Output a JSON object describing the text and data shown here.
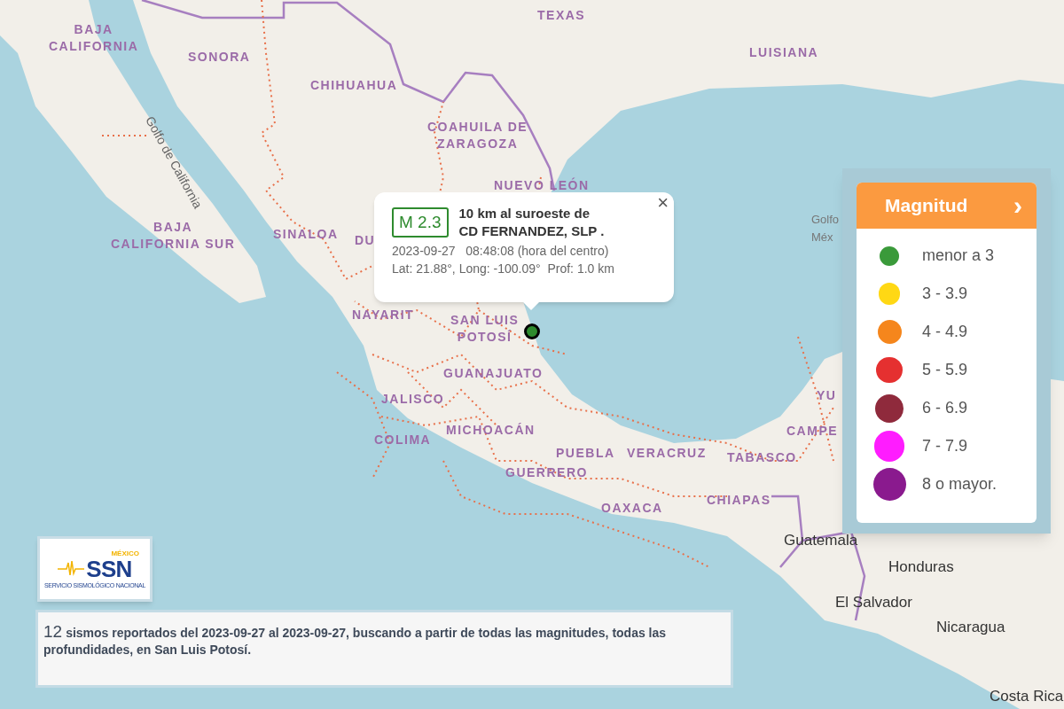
{
  "map": {
    "labels": [
      {
        "text": "TEXAS",
        "kind": "region"
      },
      {
        "text": "BAJA\nCALIFORNIA",
        "kind": "region"
      },
      {
        "text": "LUISIANA",
        "kind": "region"
      },
      {
        "text": "SONORA",
        "kind": "region"
      },
      {
        "text": "CHIHUAHUA",
        "kind": "region"
      },
      {
        "text": "Golfo de California",
        "kind": "water-rotated"
      },
      {
        "text": "COAHUILA DE\nZARAGOZA",
        "kind": "region"
      },
      {
        "text": "NUEVO LEÓN",
        "kind": "region"
      },
      {
        "text": "Golfo\nMéx",
        "kind": "water"
      },
      {
        "text": "BAJA\nCALIFORNIA SUR",
        "kind": "region"
      },
      {
        "text": "SINALOA",
        "kind": "region"
      },
      {
        "text": "DU",
        "kind": "region"
      },
      {
        "text": "NAYARIT",
        "kind": "region"
      },
      {
        "text": "SAN LUIS\nPOTOSÍ",
        "kind": "region"
      },
      {
        "text": "GUANAJUATO",
        "kind": "region"
      },
      {
        "text": "YU",
        "kind": "region"
      },
      {
        "text": "JALISCO",
        "kind": "region"
      },
      {
        "text": "MICHOACÁN",
        "kind": "region"
      },
      {
        "text": "CAMPE",
        "kind": "region"
      },
      {
        "text": "COLIMA",
        "kind": "region"
      },
      {
        "text": "PUEBLA",
        "kind": "region"
      },
      {
        "text": "VERACRUZ",
        "kind": "region"
      },
      {
        "text": "TABASCO",
        "kind": "region"
      },
      {
        "text": "GUERRERO",
        "kind": "region"
      },
      {
        "text": "CHIAPAS",
        "kind": "region"
      },
      {
        "text": "OAXACA",
        "kind": "region"
      },
      {
        "text": "Guatemala",
        "kind": "country"
      },
      {
        "text": "Honduras",
        "kind": "country"
      },
      {
        "text": "El Salvador",
        "kind": "country"
      },
      {
        "text": "Nicaragua",
        "kind": "country"
      },
      {
        "text": "Costa Rica",
        "kind": "country"
      }
    ],
    "epicenter": {
      "color": "#2e8b2e"
    }
  },
  "popup": {
    "magnitude": "M 2.3",
    "close": "×",
    "place": [
      "10 km al suroeste de",
      "CD FERNANDEZ, SLP ."
    ],
    "datetime": "2023-09-27   08:48:08 (hora del centro)",
    "coordinates": "Lat: 21.88°, Long: -100.09°  Prof: 1.0 km"
  },
  "legend": {
    "title": "Magnitud",
    "toggle": "›",
    "items": [
      {
        "label": "menor a 3",
        "color": "#3a9a3a"
      },
      {
        "label": "3 - 3.9",
        "color": "#ffd814"
      },
      {
        "label": "4 - 4.9",
        "color": "#f5861c"
      },
      {
        "label": "5 - 5.9",
        "color": "#e53030"
      },
      {
        "label": "6 - 6.9",
        "color": "#8f2a3c"
      },
      {
        "label": "7 - 7.9",
        "color": "#ff1cff"
      },
      {
        "label": "8 o mayor.",
        "color": "#8a1a8e"
      }
    ]
  },
  "logo": {
    "country": "MÉXICO",
    "acronym": "SSN",
    "name": "SERVICIO SISMOLÓGICO NACIONAL"
  },
  "summary": {
    "count": "12",
    "text": "sismos reportados del 2023-09-27 al 2023-09-27, buscando a partir de todas las magnitudes, todas las profundidades, en San Luis Potosí."
  }
}
